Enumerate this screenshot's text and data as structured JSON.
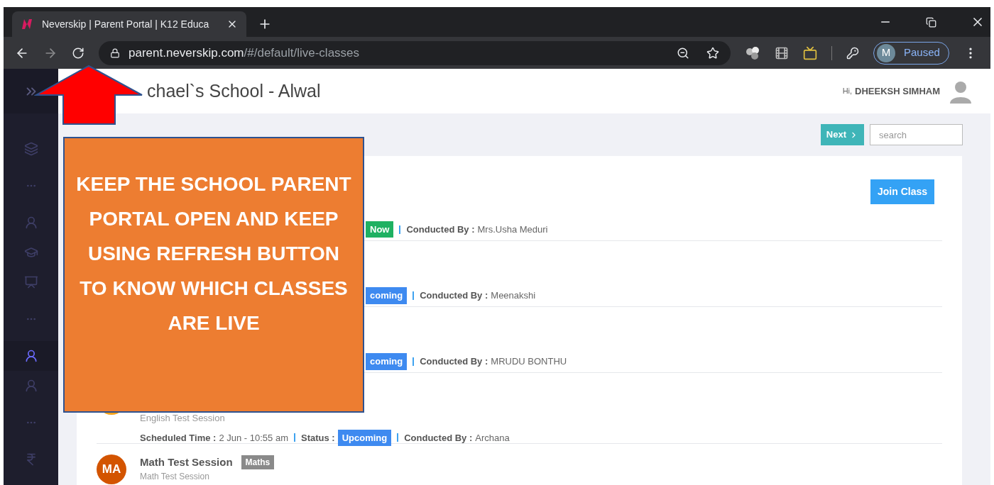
{
  "browser": {
    "tab": {
      "title": "Neverskip | Parent Portal | K12 Educa"
    },
    "url": {
      "host": "parent.neverskip.com",
      "path": "/#/default/live-classes"
    },
    "profile": {
      "initial": "M",
      "status": "Paused"
    }
  },
  "sidebar": {
    "items": [
      {
        "kind": "layers",
        "selected": false
      },
      {
        "kind": "dots",
        "selected": false
      },
      {
        "kind": "student",
        "selected": false
      },
      {
        "kind": "cap",
        "selected": false
      },
      {
        "kind": "teacher",
        "selected": false
      },
      {
        "kind": "dots",
        "selected": false
      },
      {
        "kind": "student",
        "selected": true
      },
      {
        "kind": "student",
        "selected": false
      },
      {
        "kind": "dots",
        "selected": false
      },
      {
        "kind": "rupee",
        "selected": false
      }
    ]
  },
  "header": {
    "school": "chael`s School - Alwal",
    "greeting": "Hi,",
    "user": "DHEEKSH SIMHAM"
  },
  "toolbar": {
    "next": "Next",
    "search_placeholder": "search"
  },
  "classes": [
    {
      "status": {
        "text": "Now",
        "color": "#1fb162"
      },
      "conducted_label": "Conducted By :",
      "conducted_by": "Mrs.Usha Meduri",
      "action": "Join Class"
    },
    {
      "status": {
        "text": "coming",
        "color": "#3e8af0"
      },
      "conducted_label": "Conducted By :",
      "conducted_by": "Meenakshi"
    },
    {
      "status": {
        "text": "coming",
        "color": "#3e8af0"
      },
      "conducted_label": "Conducted By :",
      "conducted_by": "MRUDU BONTHU"
    },
    {
      "color": "#f5a31a",
      "subtitle": "English Test Session",
      "time_label": "Scheduled Time :",
      "time": "2 Jun - 10:55 am",
      "status_label": "Status :",
      "status": {
        "text": "Upcoming",
        "color": "#3e8af0"
      },
      "conducted_label": "Conducted By :",
      "conducted_by": "Archana"
    },
    {
      "color": "#d35400",
      "initials": "MA",
      "title": "Math Test Session",
      "tag": "Maths",
      "subtitle": "Math Test Session"
    }
  ],
  "annotation": {
    "text": "KEEP THE SCHOOL PARENT PORTAL OPEN AND KEEP USING REFRESH BUTTON TO KNOW WHICH CLASSES ARE LIVE"
  }
}
